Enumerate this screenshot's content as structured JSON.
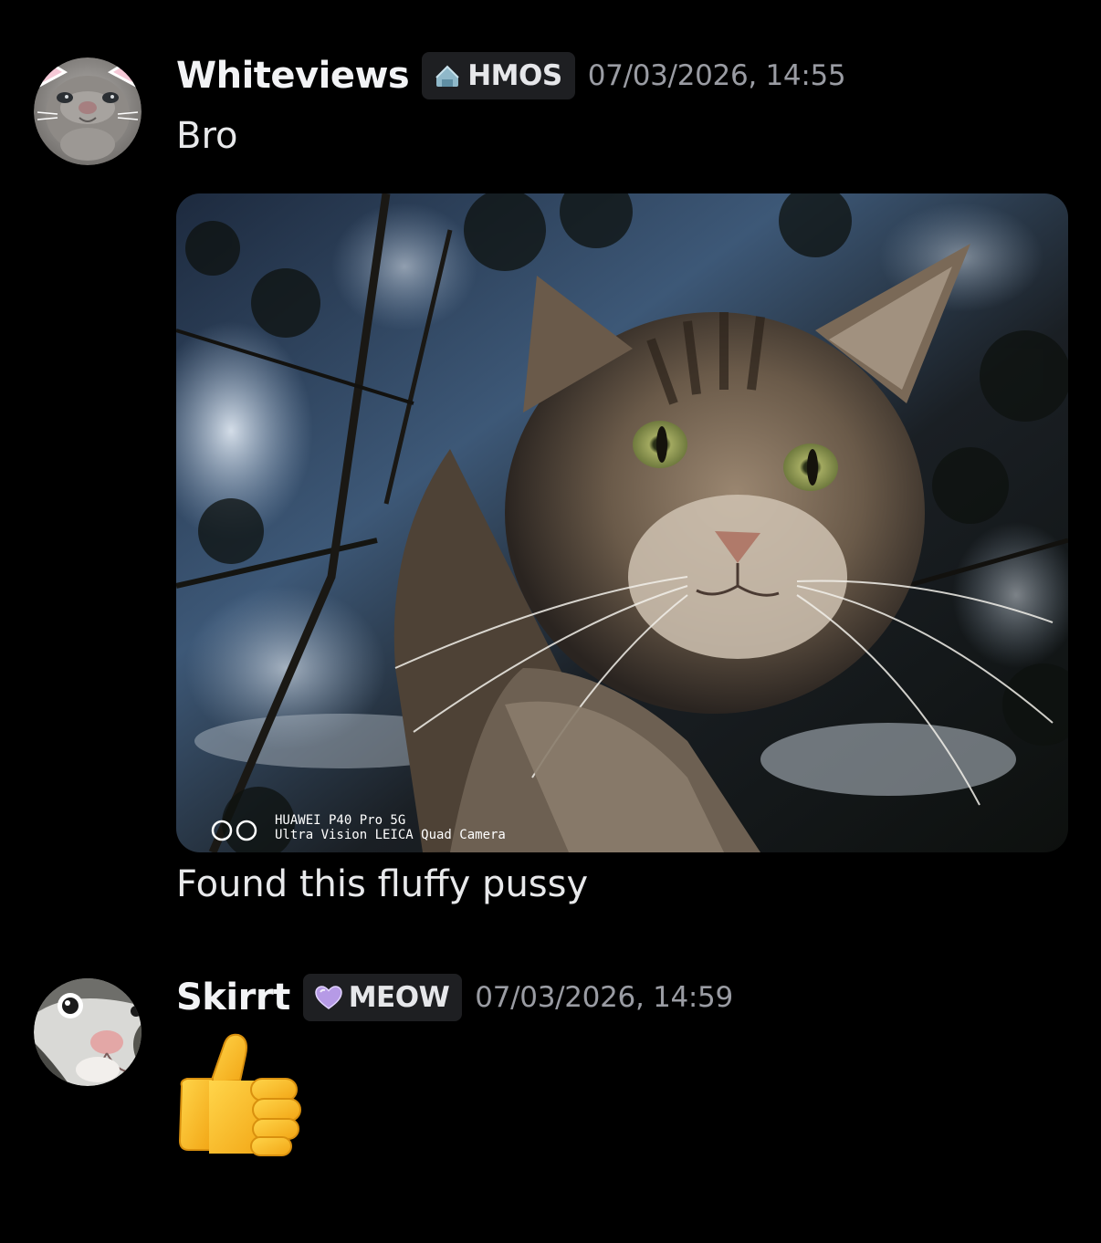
{
  "messages": [
    {
      "author": "Whiteviews",
      "role_tag": "HMOS",
      "role_icon": "house-icon",
      "timestamp": "07/03/2026, 14:55",
      "text": "Bro",
      "attachment": {
        "type": "image",
        "subject": "cat-photo",
        "watermark_line1": "HUAWEI P40 Pro 5G",
        "watermark_line2": "Ultra Vision LEICA Quad Camera",
        "watermark_logo": "OO"
      },
      "caption": "Found this fluffy pussy"
    },
    {
      "author": "Skirrt",
      "role_tag": "MEOW",
      "role_icon": "purple-heart-icon",
      "timestamp": "07/03/2026, 14:59",
      "content_emoji": "thumbs-up-emoji"
    }
  ],
  "colors": {
    "background": "#000000",
    "username": "#f2f3f5",
    "timestamp": "#9a9ca3",
    "tag_background": "#1e1f22",
    "message_text": "#e8e9eb"
  }
}
